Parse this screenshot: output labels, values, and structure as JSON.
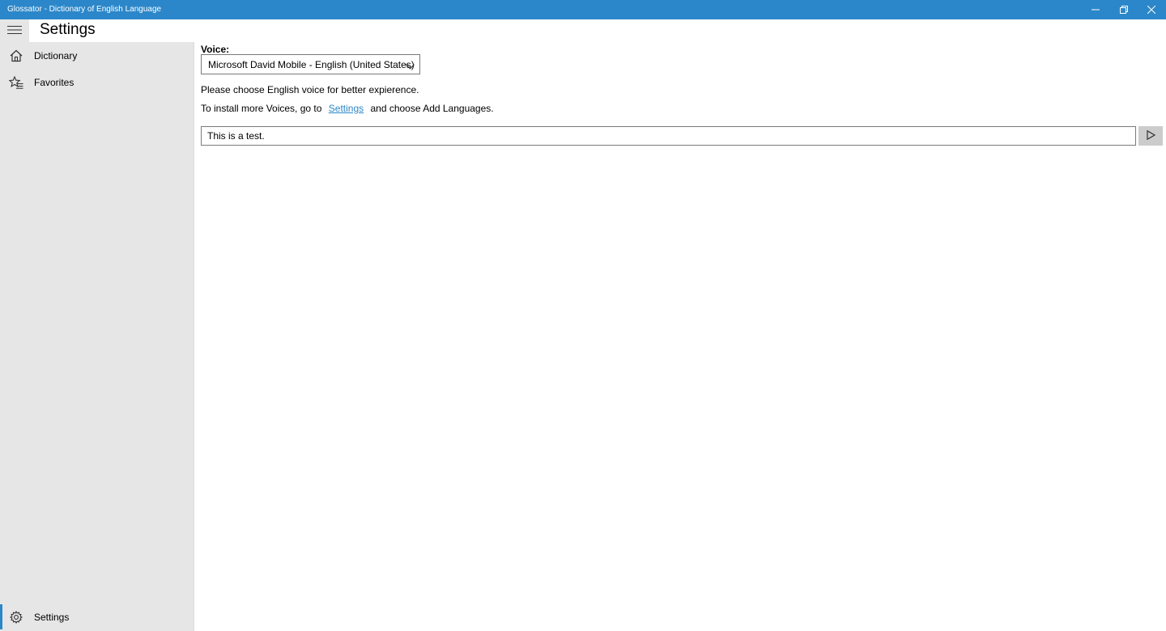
{
  "window": {
    "title": "Glossator - Dictionary of English Language",
    "accent_color": "#2b87c9",
    "controls": [
      "minimize-icon",
      "restore-icon",
      "close-icon"
    ]
  },
  "header": {
    "menu_icon": "hamburger-icon",
    "page_title": "Settings"
  },
  "sidebar": {
    "items": [
      {
        "label": "Dictionary",
        "icon": "home-icon"
      },
      {
        "label": "Favorites",
        "icon": "favorites-icon"
      }
    ],
    "footer_item": {
      "label": "Settings",
      "icon": "gear-icon",
      "selected": true
    }
  },
  "settings": {
    "voice_label": "Voice:",
    "voice_selected": "Microsoft David Mobile - English (United States)",
    "hint_choose": "Please choose English voice for better expierence.",
    "hint_install_prefix": "To install more Voices, go to",
    "hint_install_link": "Settings",
    "hint_install_suffix": "and choose Add Languages.",
    "test_text": "This is a test.",
    "play_icon": "play-icon"
  }
}
